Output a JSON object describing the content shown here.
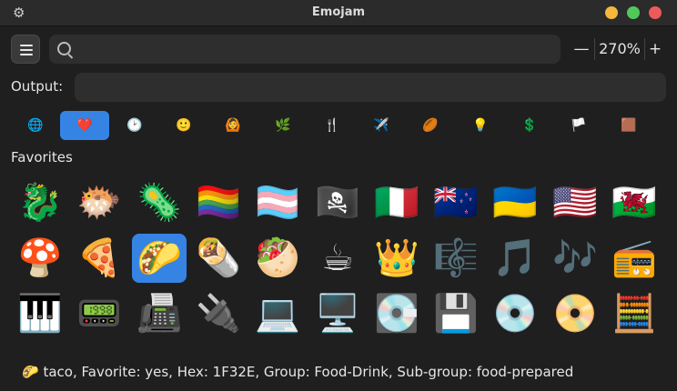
{
  "window": {
    "title": "Emojam",
    "controls": {
      "minimize_color": "#f6b73c",
      "maximize_color": "#4ec95a",
      "close_color": "#ee5a5a"
    }
  },
  "toolbar": {
    "menu_icon": "hamburger-icon",
    "search": {
      "value": "",
      "placeholder": "",
      "icon": "search-icon"
    },
    "zoom": {
      "minus": "—",
      "value": "270%",
      "plus": "+"
    }
  },
  "output": {
    "label": "Output:",
    "value": ""
  },
  "categories": [
    {
      "name": "globe",
      "glyph": "🌐",
      "active": false
    },
    {
      "name": "favorites",
      "glyph": "❤️",
      "active": true
    },
    {
      "name": "recent",
      "glyph": "🕑",
      "active": false
    },
    {
      "name": "smileys",
      "glyph": "🙂",
      "active": false
    },
    {
      "name": "people",
      "glyph": "🙆",
      "active": false
    },
    {
      "name": "nature",
      "glyph": "🌿",
      "active": false
    },
    {
      "name": "food",
      "glyph": "🍴",
      "active": false
    },
    {
      "name": "travel",
      "glyph": "✈️",
      "active": false
    },
    {
      "name": "activities",
      "glyph": "🏉",
      "active": false
    },
    {
      "name": "objects",
      "glyph": "💡",
      "active": false
    },
    {
      "name": "symbols",
      "glyph": "💲",
      "active": false
    },
    {
      "name": "flags",
      "glyph": "🏳️",
      "active": false
    },
    {
      "name": "custom",
      "glyph": "🟫",
      "active": false
    }
  ],
  "section": {
    "title": "Favorites"
  },
  "emojis": [
    [
      "🐉",
      "🐡",
      "🦠",
      "🏳️‍🌈",
      "🏳️‍⚧️",
      "🏴‍☠️",
      "🇮🇹",
      "🇳🇿",
      "🇺🇦",
      "🇺🇸",
      "🏴󠁧󠁢󠁷󠁬󠁳󠁿"
    ],
    [
      "🍄",
      "🍕",
      "🌮",
      "🌯",
      "🥙",
      "☕",
      "👑",
      "🎼",
      "🎵",
      "🎶",
      "📻"
    ],
    [
      "🎹",
      "📟",
      "📠",
      "🔌",
      "💻",
      "🖥️",
      "💽",
      "💾",
      "💿",
      "📀",
      "🧮"
    ]
  ],
  "selected": {
    "row": 1,
    "col": 2
  },
  "status": {
    "glyph": "🌮",
    "text": "taco, Favorite: yes, Hex: 1F32E, Group: Food-Drink, Sub-group: food-prepared"
  },
  "colors": {
    "accent": "#3584e4",
    "background": "#1f1f1f",
    "titlebar": "#2b2b2b"
  }
}
